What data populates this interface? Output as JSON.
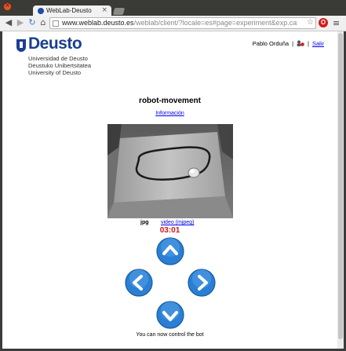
{
  "browser": {
    "tab_title": "WebLab-Deusto",
    "url_host": "www.weblab.deusto.es",
    "url_path": "/weblab/client/?locale=es#page=experiment&exp.category=Robot%..."
  },
  "logo": {
    "name": "Deusto",
    "line1": "Universidad de Deusto",
    "line2": "Deustuko Unibertsitatea",
    "line3": "University of Deusto"
  },
  "user": {
    "name": "Pablo Orduña",
    "separator": "|",
    "logout": "Salir"
  },
  "experiment": {
    "title": "robot-movement",
    "info_link": "Información",
    "format_jpg": "jpg",
    "format_video": "video (mjpeg)",
    "timer": "03:01",
    "status": "You can now control the bot"
  },
  "controls": {
    "up": "chevron-up-icon",
    "left": "chevron-left-icon",
    "right": "chevron-right-icon",
    "down": "chevron-down-icon",
    "button_color": "#2a7fd4"
  }
}
